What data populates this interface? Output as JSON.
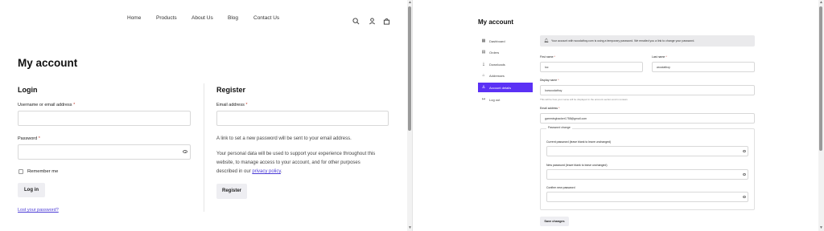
{
  "left": {
    "nav": {
      "items": [
        "Home",
        "Products",
        "About Us",
        "Blog",
        "Contact Us"
      ]
    },
    "nav_icons": [
      "search-icon",
      "user-icon",
      "bag-icon"
    ],
    "page_title": "My account",
    "login": {
      "heading": "Login",
      "username_label": "Username or email address",
      "password_label": "Password",
      "required_mark": "*",
      "remember_label": "Remember me",
      "login_button": "Log in",
      "lost_password": "Lost your password?"
    },
    "register": {
      "heading": "Register",
      "email_label": "Email address",
      "required_mark": "*",
      "info_text": "A link to set a new password will be sent to your email address.",
      "privacy_text_1": "Your personal data will be used to support your experience throughout this",
      "privacy_text_2": "website, to manage access to your account, and for other purposes",
      "privacy_text_3": "described in our",
      "privacy_link": "privacy policy",
      "privacy_end": ".",
      "register_button": "Register"
    }
  },
  "right": {
    "page_title": "My account",
    "sidebar": {
      "items": [
        {
          "label": "Dashboard",
          "icon": "dashboard-icon",
          "glyph": "▦"
        },
        {
          "label": "Orders",
          "icon": "orders-icon",
          "glyph": "▤"
        },
        {
          "label": "Downloads",
          "icon": "download-icon",
          "glyph": "⤓"
        },
        {
          "label": "Addresses",
          "icon": "home-icon",
          "glyph": "⌂"
        },
        {
          "label": "Account details",
          "icon": "user-icon",
          "glyph": "♙"
        },
        {
          "label": "Log out",
          "icon": "logout-icon",
          "glyph": "↦"
        }
      ],
      "active_index": 4
    },
    "notice": "Your account with woodathoy.com is using a temporary password. We emailed you a link to change your password.",
    "first_name_label": "First name",
    "first_name_value": "loc",
    "last_name_label": "Last name",
    "last_name_value": "woodathoy",
    "display_name_label": "Display name",
    "display_name_value": "locwoodathoy",
    "display_name_note": "This will be how your name will be displayed in the account section and in reviews",
    "email_label": "Email address",
    "email_value": "gamminghacker1758@gmail.com",
    "required_mark": "*",
    "password_change_legend": "Password change",
    "current_password_label": "Current password (leave blank to leave unchanged)",
    "new_password_label": "New password (leave blank to leave unchanged)",
    "confirm_password_label": "Confirm new password",
    "save_button": "Save changes"
  },
  "colors": {
    "accent": "#5b31f5",
    "link": "#4b3bd6",
    "required": "#c0392b",
    "button_bg": "#eeeef2"
  }
}
